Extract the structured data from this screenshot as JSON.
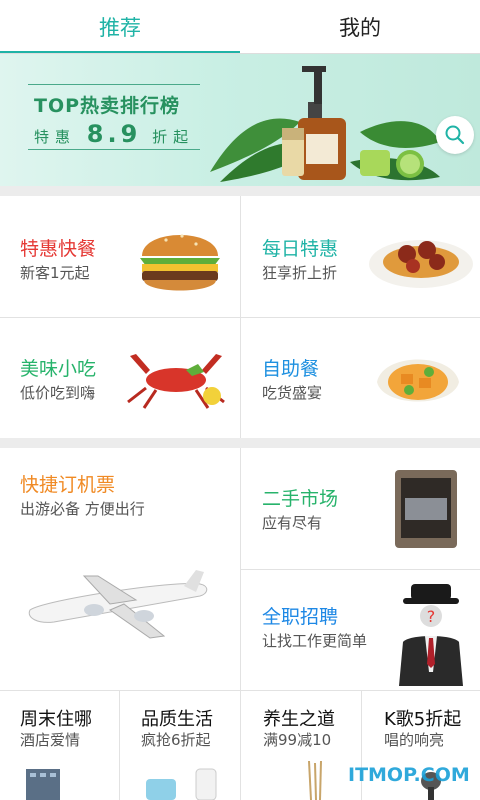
{
  "tabs": [
    {
      "label": "推荐",
      "active": true
    },
    {
      "label": "我的",
      "active": false
    }
  ],
  "banner": {
    "title": "TOP热卖排行榜",
    "sub_prefix": "特惠",
    "sub_value": "8.9",
    "sub_suffix": "折起",
    "search_icon": "search-icon"
  },
  "section1": [
    {
      "title": "特惠快餐",
      "subtitle": "新客1元起",
      "color": "#e53935",
      "icon": "burger-icon"
    },
    {
      "title": "每日特惠",
      "subtitle": "狂享折上折",
      "color": "#1fb3a6",
      "icon": "spaghetti-icon"
    },
    {
      "title": "美味小吃",
      "subtitle": "低价吃到嗨",
      "color": "#27b36b",
      "icon": "lobster-icon"
    },
    {
      "title": "自助餐",
      "subtitle": "吃货盛宴",
      "color": "#1e90e0",
      "icon": "dish-icon"
    }
  ],
  "section2": {
    "big": {
      "title": "快捷订机票",
      "subtitle": "出游必备 方便出行",
      "color": "#f08a24",
      "icon": "airplane-icon"
    },
    "right": [
      {
        "title": "二手市场",
        "subtitle": "应有尽有",
        "color": "#27b36b",
        "icon": "phone-icon"
      },
      {
        "title": "全职招聘",
        "subtitle": "让找工作更简单",
        "color": "#1e88e5",
        "icon": "businessman-icon"
      }
    ]
  },
  "section3": [
    {
      "title": "周末住哪",
      "subtitle": "酒店爱情",
      "icon": "building-icon"
    },
    {
      "title": "品质生活",
      "subtitle": "疯抢6折起",
      "icon": "bottles-icon"
    },
    {
      "title": "养生之道",
      "subtitle": "满99减10",
      "icon": "incense-icon"
    },
    {
      "title": "K歌5折起",
      "subtitle": "唱的响亮",
      "icon": "microphone-icon"
    }
  ],
  "watermark": "ITMOP.COM",
  "colors": {
    "accent": "#1fb3a6",
    "background": "#ececec"
  }
}
